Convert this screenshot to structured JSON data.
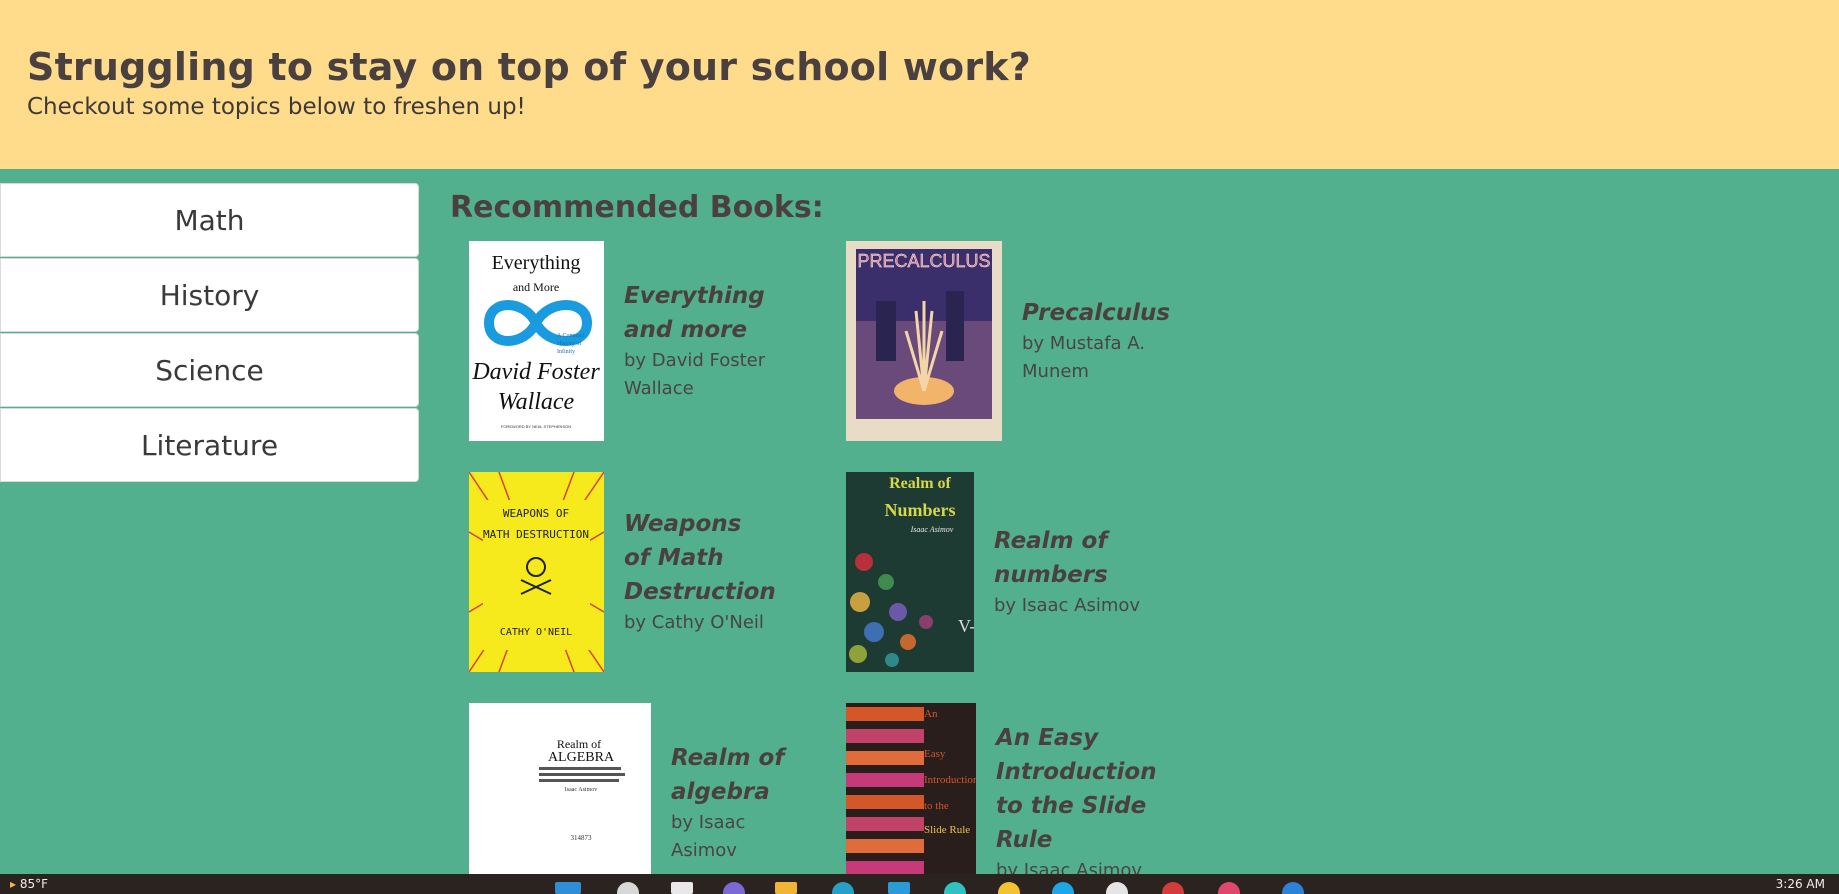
{
  "banner": {
    "heading": "Struggling to stay on top of your school work?",
    "subheading": "Checkout some topics below to freshen up!"
  },
  "topics": [
    {
      "label": "Math"
    },
    {
      "label": "History"
    },
    {
      "label": "Science"
    },
    {
      "label": "Literature"
    }
  ],
  "books_section": {
    "title": "Recommended Books:"
  },
  "books": [
    {
      "title": "Everything and more",
      "author": "by David Foster Wallace",
      "cover_text": [
        "Everything",
        "and More",
        "A Compact History of Infinity",
        "David Foster",
        "Wallace",
        "FOREWORD BY NEAL STEPHENSON"
      ]
    },
    {
      "title": "Precalculus",
      "author": "by Mustafa A. Munem",
      "cover_text": [
        "PRECALCULUS"
      ]
    },
    {
      "title": "Weapons of Math Destruction",
      "author": "by Cathy O'Neil",
      "cover_text": [
        "WEAPONS OF",
        "MATH DESTRUCTION",
        "CATHY O'NEIL"
      ]
    },
    {
      "title": "Realm of numbers",
      "author": "by Isaac Asimov",
      "cover_text": [
        "Realm of",
        "Numbers",
        "Isaac Asimov"
      ]
    },
    {
      "title": "Realm of algebra",
      "author": "by Isaac Asimov",
      "cover_text": [
        "Realm of",
        "ALGEBRA",
        "Isaac Asimov",
        "314873"
      ]
    },
    {
      "title": "An Easy Introduction to the Slide Rule",
      "author": "by Isaac Asimov",
      "cover_text": [
        "An",
        "Easy",
        "Introduction",
        "to the",
        "Slide Rule"
      ]
    }
  ],
  "taskbar": {
    "weather": "85°F",
    "time": "3:26 AM"
  },
  "colors": {
    "banner": "#fedc8c",
    "background": "#52b08f",
    "text": "#4a4040"
  }
}
